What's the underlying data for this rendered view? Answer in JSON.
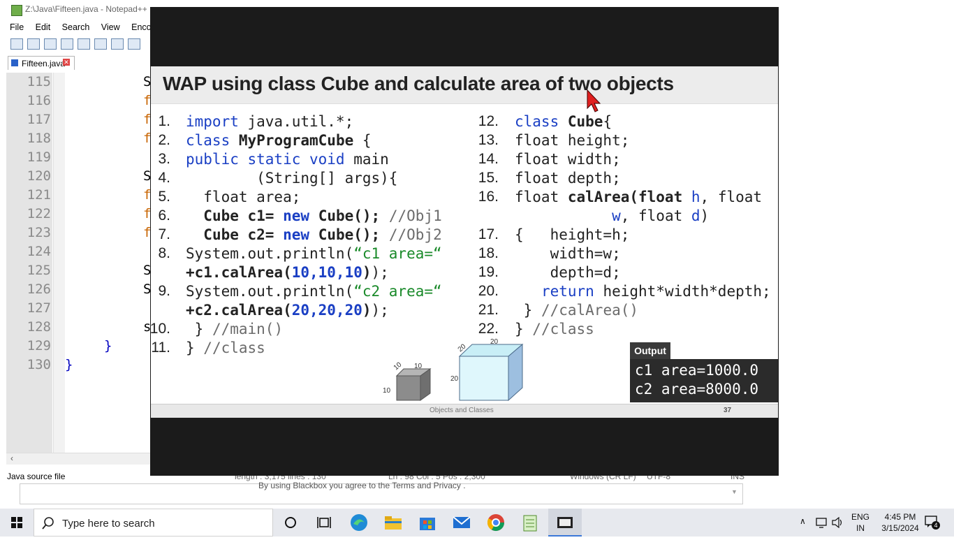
{
  "npp": {
    "title": "Z:\\Java\\Fifteen.java - Notepad++",
    "menu": [
      "File",
      "Edit",
      "Search",
      "View",
      "Encoding"
    ],
    "tab_label": "Fifteen.java",
    "line_numbers": [
      "115",
      "116",
      "117",
      "118",
      "119",
      "120",
      "121",
      "122",
      "123",
      "124",
      "125",
      "126",
      "127",
      "128",
      "129",
      "130"
    ],
    "code_fragments": [
      {
        "text": "S"
      },
      {
        "text": "f"
      },
      {
        "text": "f"
      },
      {
        "text": "f"
      },
      {
        "text": "S"
      },
      {
        "text": "f"
      },
      {
        "text": "f"
      },
      {
        "text": "f"
      },
      {
        "text": "S"
      },
      {
        "text": "S"
      },
      {
        "text": "s"
      },
      {
        "text": "}"
      },
      {
        "text": "}"
      }
    ],
    "status": {
      "file_type": "Java source file",
      "length": "length : 3,175    lines : 130",
      "position": "Ln : 98    Col : 5    Pos : 2,300",
      "eol": "Windows (CR LF)",
      "encoding": "UTF-8",
      "mode": "INS"
    },
    "footer_notice": "By using Blackbox you agree to the Terms    and Privacy   ."
  },
  "slide": {
    "title": "WAP using class Cube and calculate area of two objects",
    "left_numbers": [
      "1.",
      "2.",
      "3.",
      "4.",
      "5.",
      "6.",
      "7.",
      "8.",
      "9.",
      "10.",
      "11."
    ],
    "right_numbers": [
      "12.",
      "13.",
      "14.",
      "15.",
      "16.",
      "17.",
      "18.",
      "19.",
      "20.",
      "21.",
      "22."
    ],
    "output_label": "Output",
    "output_lines": [
      "c1 area=1000.0",
      "c2 area=8000.0"
    ],
    "footer_text": "Objects and Classes",
    "page_number": "37",
    "cube_labels": {
      "small": [
        "10",
        "10",
        "10"
      ],
      "big": [
        "20",
        "20",
        "20"
      ]
    }
  },
  "taskbar": {
    "search_placeholder": "Type here to search",
    "lang_top": "ENG",
    "lang_bottom": "IN",
    "time": "4:45 PM",
    "date": "3/15/2024",
    "notification_count": "4"
  }
}
